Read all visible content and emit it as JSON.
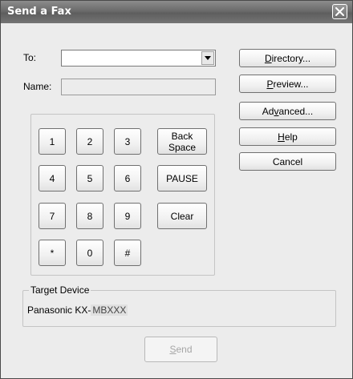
{
  "window": {
    "title": "Send a Fax"
  },
  "form": {
    "to_label": "To:",
    "to_value": "",
    "name_label": "Name:",
    "name_value": ""
  },
  "side_buttons": {
    "directory": {
      "mn": "D",
      "rest": "irectory..."
    },
    "preview": {
      "mn": "P",
      "rest": "review..."
    },
    "advanced": {
      "pre": "Ad",
      "mn": "v",
      "rest": "anced..."
    },
    "help": {
      "mn": "H",
      "rest": "elp"
    },
    "cancel": "Cancel"
  },
  "keypad": {
    "keys": [
      "1",
      "2",
      "3",
      "4",
      "5",
      "6",
      "7",
      "8",
      "9",
      "*",
      "0",
      "#"
    ],
    "backspace_line1": "Back",
    "backspace_line2": "Space",
    "pause": "PAUSE",
    "clear": "Clear"
  },
  "target_device": {
    "group_label": "Target Device",
    "brand": "Panasonic KX-",
    "model": "MBXXX"
  },
  "send": {
    "mn": "S",
    "rest": "end",
    "enabled": false
  }
}
